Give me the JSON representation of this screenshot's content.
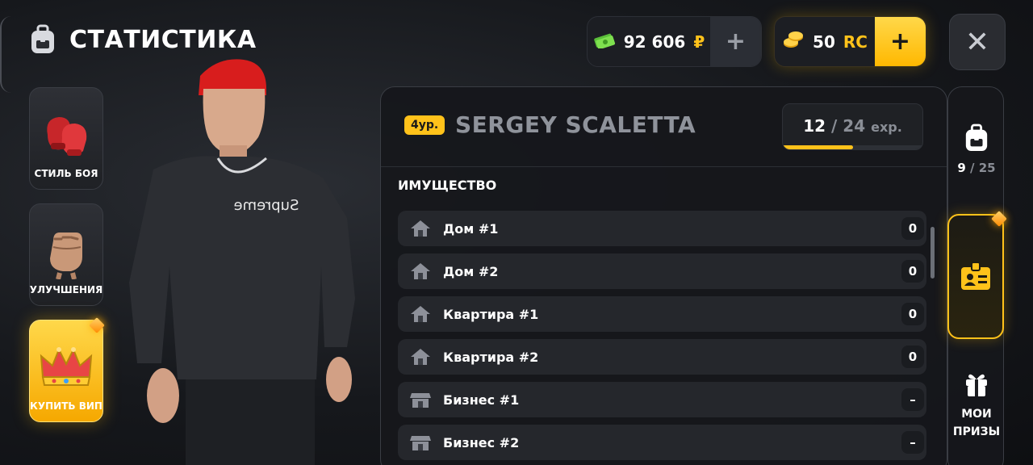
{
  "header": {
    "title": "СТАТИСТИКА",
    "title_icon": "backpack-icon"
  },
  "currency": {
    "money_amount": "92 606",
    "money_symbol": "₽",
    "money_plus": "+",
    "rc_amount": "50",
    "rc_unit": "RC",
    "rc_plus": "+",
    "close_label": "✕"
  },
  "side_menu": {
    "items": [
      {
        "label": "СТИЛЬ БОЯ",
        "icon": "boxing-gloves-icon"
      },
      {
        "label": "УЛУЧШЕНИЯ",
        "icon": "fist-icon"
      },
      {
        "label": "КУПИТЬ ВИП",
        "icon": "crown-icon"
      }
    ]
  },
  "player": {
    "level": "4ур.",
    "name": "SERGEY SCALETTA",
    "exp_current": "12",
    "exp_sep": "/",
    "exp_max": "24",
    "exp_unit": "exp.",
    "exp_progress": 0.5
  },
  "property": {
    "title": "ИМУЩЕСТВО",
    "items": [
      {
        "name": "Дом #1",
        "value": "0",
        "icon": "house-icon"
      },
      {
        "name": "Дом #2",
        "value": "0",
        "icon": "house-icon"
      },
      {
        "name": "Квартира #1",
        "value": "0",
        "icon": "house-icon"
      },
      {
        "name": "Квартира #2",
        "value": "0",
        "icon": "house-icon"
      },
      {
        "name": "Бизнес #1",
        "value": "–",
        "icon": "shop-icon"
      },
      {
        "name": "Бизнес #2",
        "value": "–",
        "icon": "shop-icon"
      }
    ]
  },
  "rail": {
    "inventory_current": "9",
    "inventory_sep": "/",
    "inventory_max": "25",
    "prizes_line1": "МОИ",
    "prizes_line2": "ПРИЗЫ"
  },
  "colors": {
    "accent": "#ffc21a",
    "panel": "#16171b",
    "row": "#25272c"
  }
}
